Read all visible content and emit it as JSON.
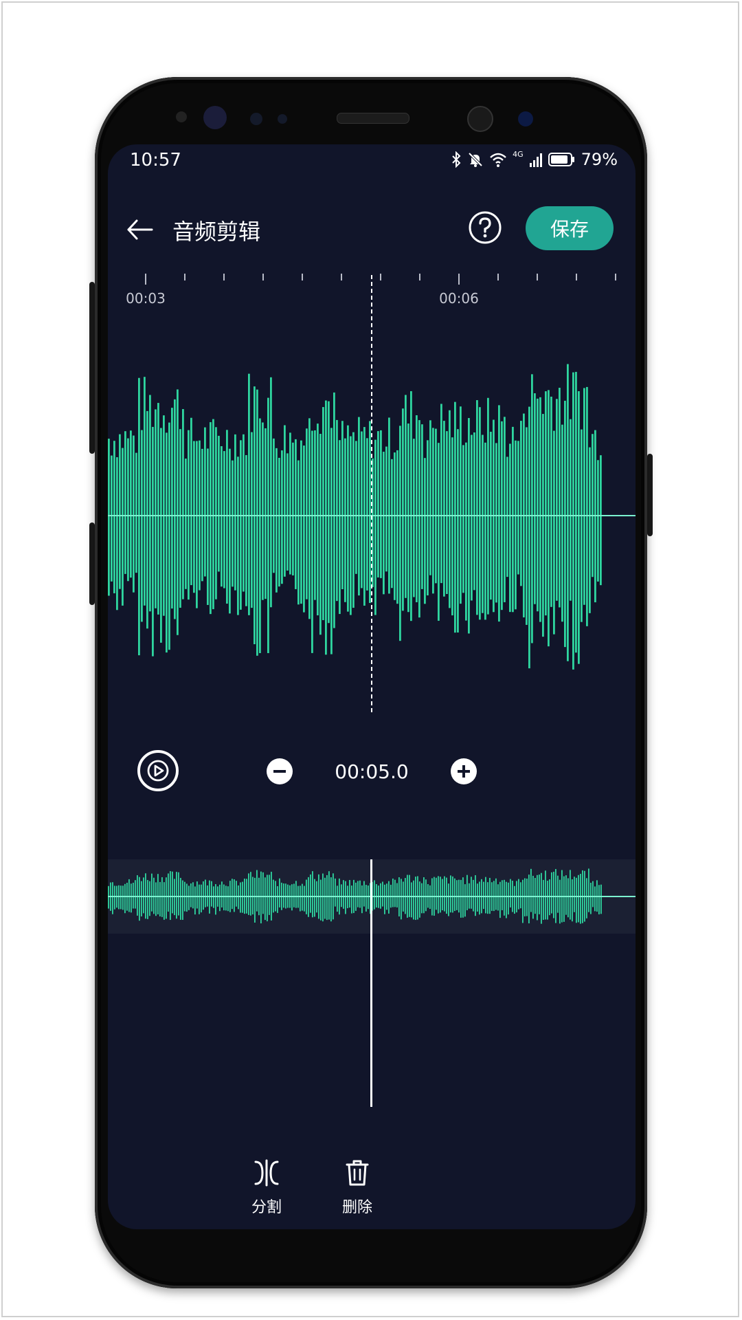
{
  "status_bar": {
    "time": "10:57",
    "network": "4G",
    "battery": "79%"
  },
  "header": {
    "title": "音频剪辑",
    "save_label": "保存"
  },
  "timeline": {
    "labels": [
      "00:03",
      "00:06"
    ]
  },
  "playback": {
    "timecode": "00:05.0"
  },
  "tools": {
    "split_label": "分割",
    "delete_label": "删除"
  },
  "colors": {
    "background": "#11152a",
    "accent": "#21a593",
    "waveform": "#2fd6a0"
  }
}
